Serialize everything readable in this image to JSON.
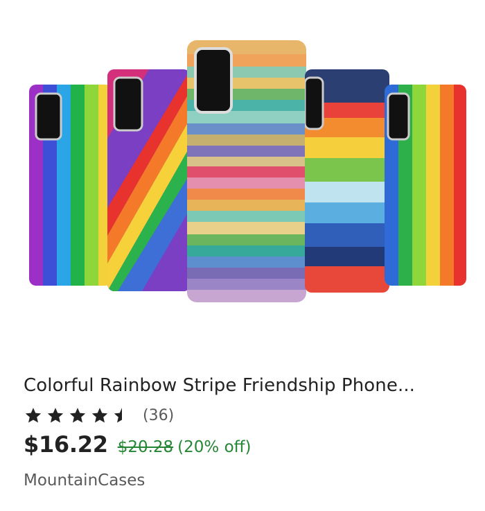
{
  "product": {
    "title": "Colorful Rainbow Stripe Friendship Phone...",
    "rating": 4.5,
    "review_count": "(36)",
    "price": "$16.22",
    "original_price": "$20.28",
    "discount": "(20% off)",
    "shop_name": "MountainCases"
  },
  "colors": {
    "text": "#222222",
    "muted": "#595959",
    "sale_green": "#258635"
  },
  "icons": [
    "star-icon",
    "half-star-icon"
  ]
}
